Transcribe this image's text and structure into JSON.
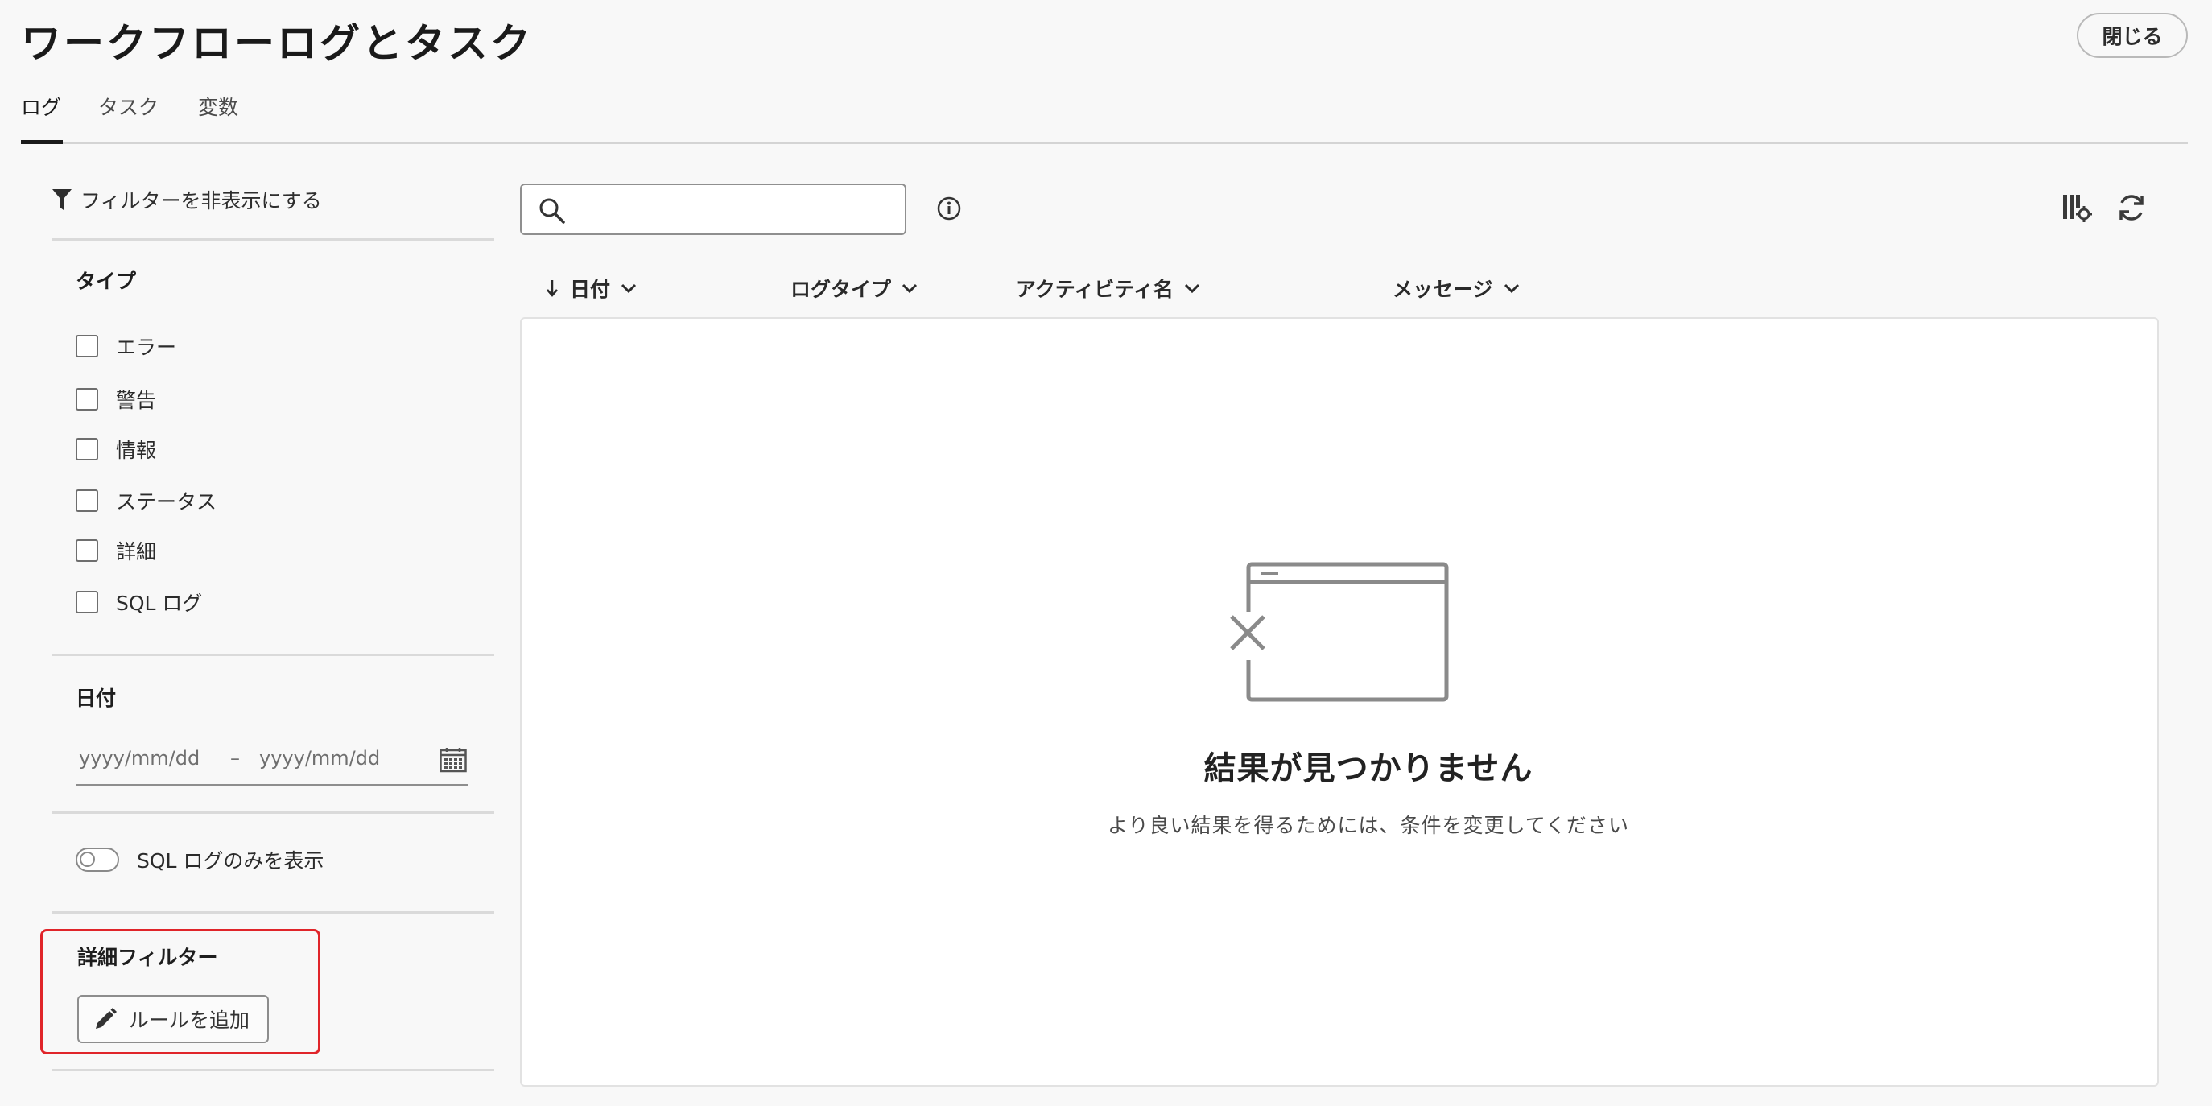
{
  "header": {
    "title": "ワークフローログとタスク",
    "close_label": "閉じる"
  },
  "tabs": [
    {
      "label": "ログ",
      "active": true
    },
    {
      "label": "タスク",
      "active": false
    },
    {
      "label": "変数",
      "active": false
    }
  ],
  "sidebar": {
    "hide_filters_label": "フィルターを非表示にする",
    "type_section": {
      "label": "タイプ",
      "options": [
        {
          "label": "エラー",
          "checked": false
        },
        {
          "label": "警告",
          "checked": false
        },
        {
          "label": "情報",
          "checked": false
        },
        {
          "label": "ステータス",
          "checked": false
        },
        {
          "label": "詳細",
          "checked": false
        },
        {
          "label": "SQL ログ",
          "checked": false
        }
      ]
    },
    "date_section": {
      "label": "日付",
      "start_placeholder": "yyyy/mm/dd",
      "separator": "–",
      "end_placeholder": "yyyy/mm/dd"
    },
    "sql_only_toggle": {
      "label": "SQL ログのみを表示",
      "on": false
    },
    "advanced_filter": {
      "label": "詳細フィルター",
      "add_rule_label": "ルールを追加",
      "highlight_color": "#e0252a"
    }
  },
  "main": {
    "search": {
      "value": "",
      "placeholder": ""
    },
    "columns": [
      {
        "label": "日付",
        "sorted": "descending"
      },
      {
        "label": "ログタイプ"
      },
      {
        "label": "アクティビティ名"
      },
      {
        "label": "メッセージ"
      }
    ],
    "empty_state": {
      "title": "結果が見つかりません",
      "subtitle": "より良い結果を得るためには、条件を変更してください"
    }
  }
}
